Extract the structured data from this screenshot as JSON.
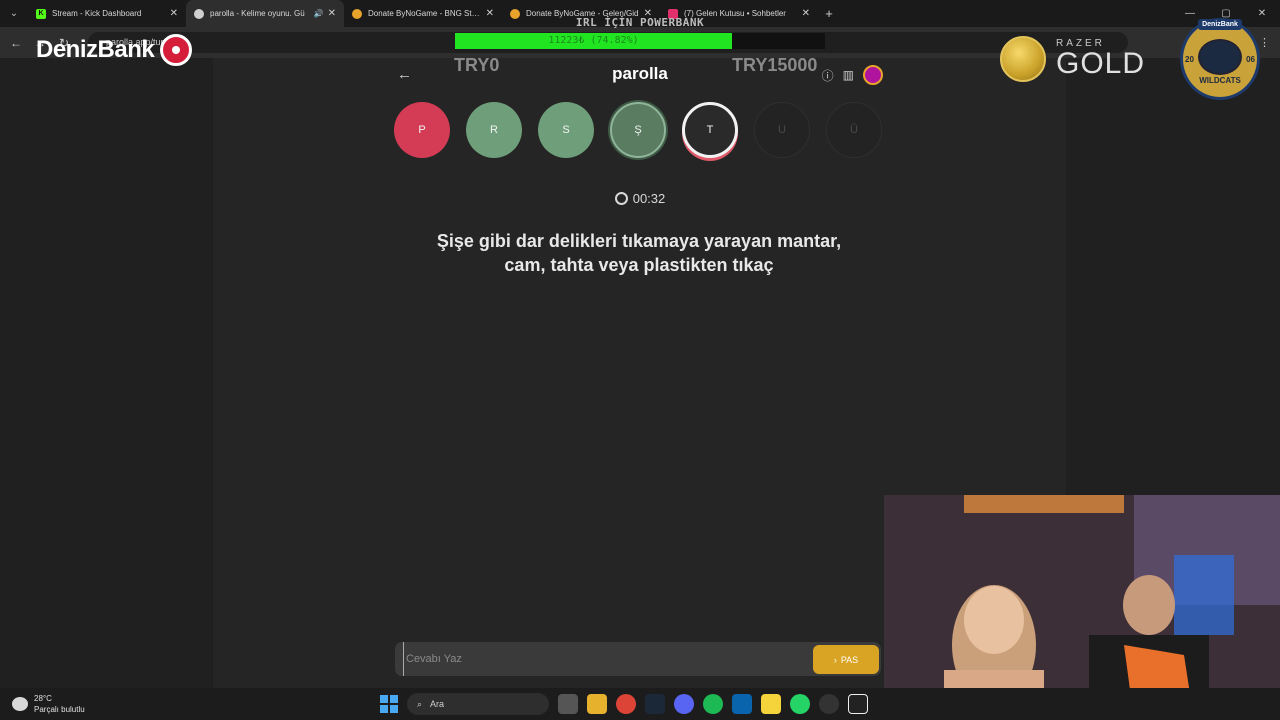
{
  "browser": {
    "tabs": [
      {
        "title": "Stream - Kick Dashboard",
        "favicon": "kick-icon",
        "color": "#53fc18",
        "active": false
      },
      {
        "title": "parolla - Kelime oyunu. Gü",
        "favicon": "parolla-icon",
        "color": "#d0d0d0",
        "active": true
      },
      {
        "title": "Donate ByNoGame - BNG Strea",
        "favicon": "bynogame-icon",
        "color": "#e8a32b",
        "active": false
      },
      {
        "title": "Donate ByNoGame - Gelen/Gid",
        "favicon": "bynogame-icon",
        "color": "#e8a32b",
        "active": false
      },
      {
        "title": "(7) Gelen Kutusu • Sohbetler",
        "favicon": "instagram-icon",
        "color": "#e1306c",
        "active": false
      }
    ],
    "url": "parolla.app/tur..."
  },
  "game": {
    "title": "parolla",
    "letters": [
      "P",
      "R",
      "S",
      "Ş",
      "T",
      "U",
      "Ü"
    ],
    "timer": "00:32",
    "question": "Şişe gibi dar delikleri tıkamaya yarayan mantar, cam, tahta veya plastikten tıkaç",
    "answer_placeholder": "Cevabı Yaz",
    "pass_label": "PAS"
  },
  "overlay": {
    "sponsor": "DenizBank",
    "powerbank_title": "IRL İÇİN POWERBANK",
    "powerbank_amount": "11223₺ (74.82%)",
    "powerbank_progress": 0.7482,
    "goal_start": "TRY0",
    "goal_end": "TRY15000",
    "razer_brand": "RAZER",
    "razer_product": "GOLD",
    "team_sponsor": "DenizBank",
    "team_year_left": "20",
    "team_year_right": "06",
    "team_name": "WILDCATS"
  },
  "taskbar": {
    "temperature": "28°C",
    "weather_desc": "Parçalı bulutlu",
    "search_label": "Ara"
  }
}
